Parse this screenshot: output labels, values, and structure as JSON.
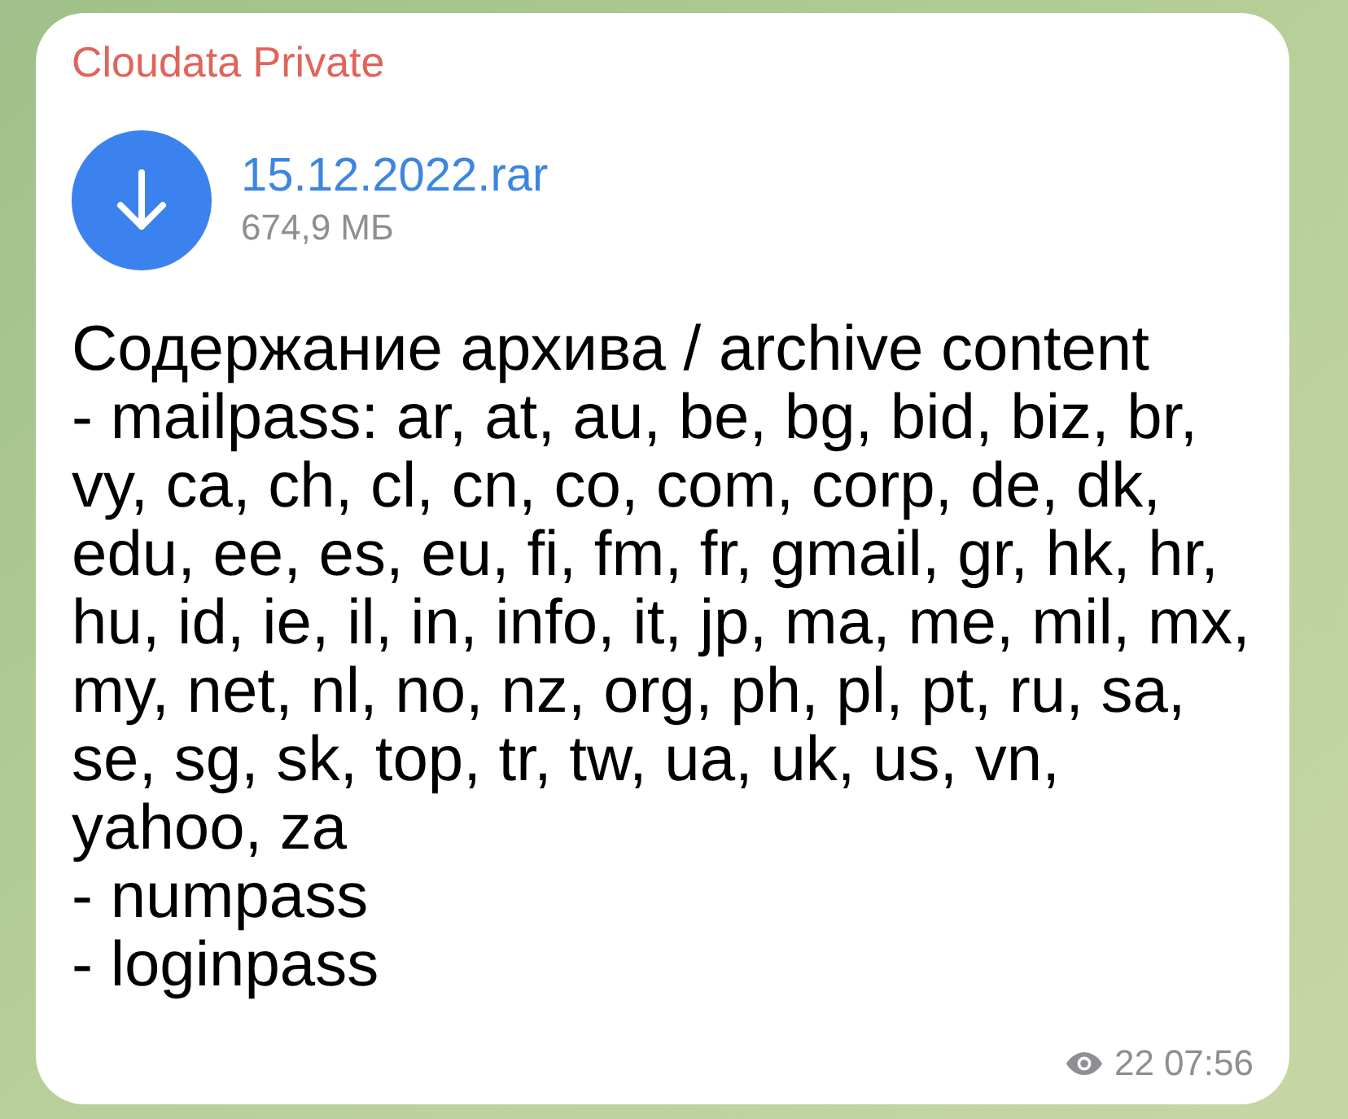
{
  "message": {
    "sender": "Cloudata Private",
    "file": {
      "name": "15.12.2022.rar",
      "size": "674,9 МБ"
    },
    "text": "Содержание архива / archive content\n- mailpass: ar, at, au, be, bg, bid, biz, br,\nvy, ca, ch, cl, cn, co, com, corp, de, dk,\nedu, ee, es, eu, fi, fm, fr, gmail, gr, hk, hr,\nhu, id, ie, il, in, info, it, jp, ma, me, mil, mx,\nmy, net, nl, no, nz, org, ph, pl, pt, ru, sa,\nse, sg, sk, top, tr, tw, ua, uk, us, vn,\nyahoo, za\n- numpass\n- loginpass",
    "views": "22",
    "time": "07:56"
  }
}
